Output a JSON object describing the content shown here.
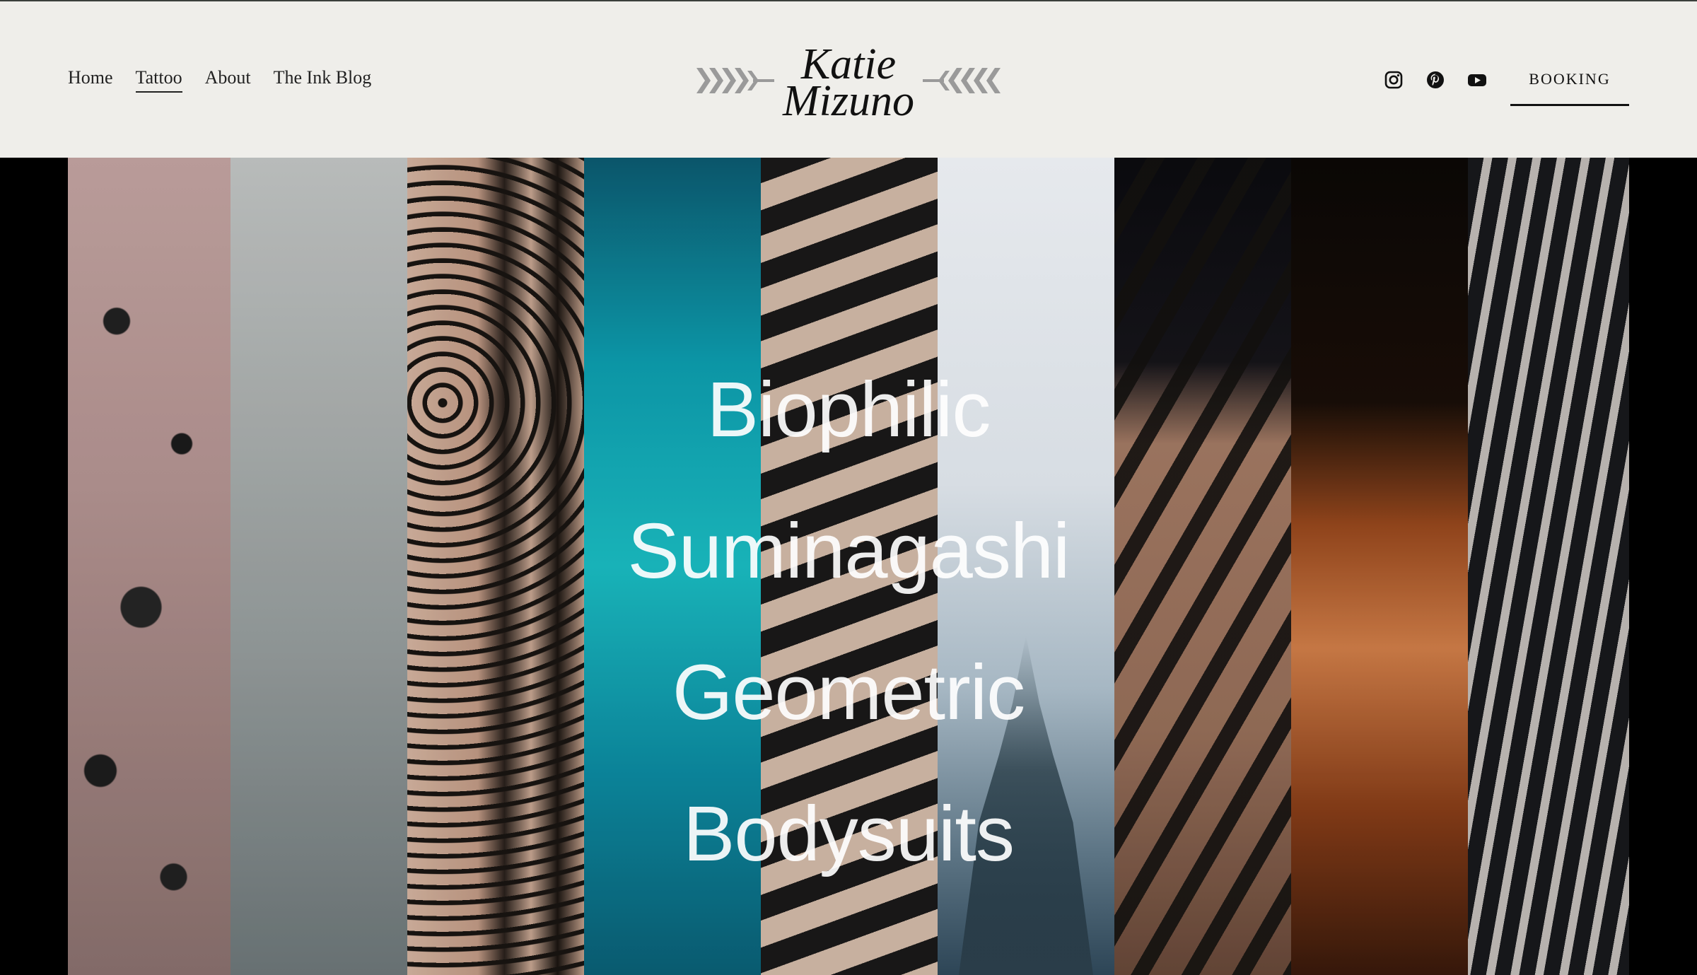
{
  "nav": {
    "items": [
      {
        "label": "Home",
        "active": false
      },
      {
        "label": "Tattoo",
        "active": true
      },
      {
        "label": "About",
        "active": false
      },
      {
        "label": "The Ink Blog",
        "active": false
      }
    ]
  },
  "logo": {
    "line1": "Katie",
    "line2": "Mizuno"
  },
  "social": {
    "icons": [
      "instagram-icon",
      "pinterest-icon",
      "youtube-icon"
    ]
  },
  "booking": {
    "label": "BOOKING"
  },
  "hero": {
    "styles": [
      "Biophilic",
      "Suminagashi",
      "Geometric",
      "Bodysuits"
    ]
  },
  "colors": {
    "header_bg": "#efeeea",
    "text": "#111111",
    "hero_bg": "#000000"
  }
}
